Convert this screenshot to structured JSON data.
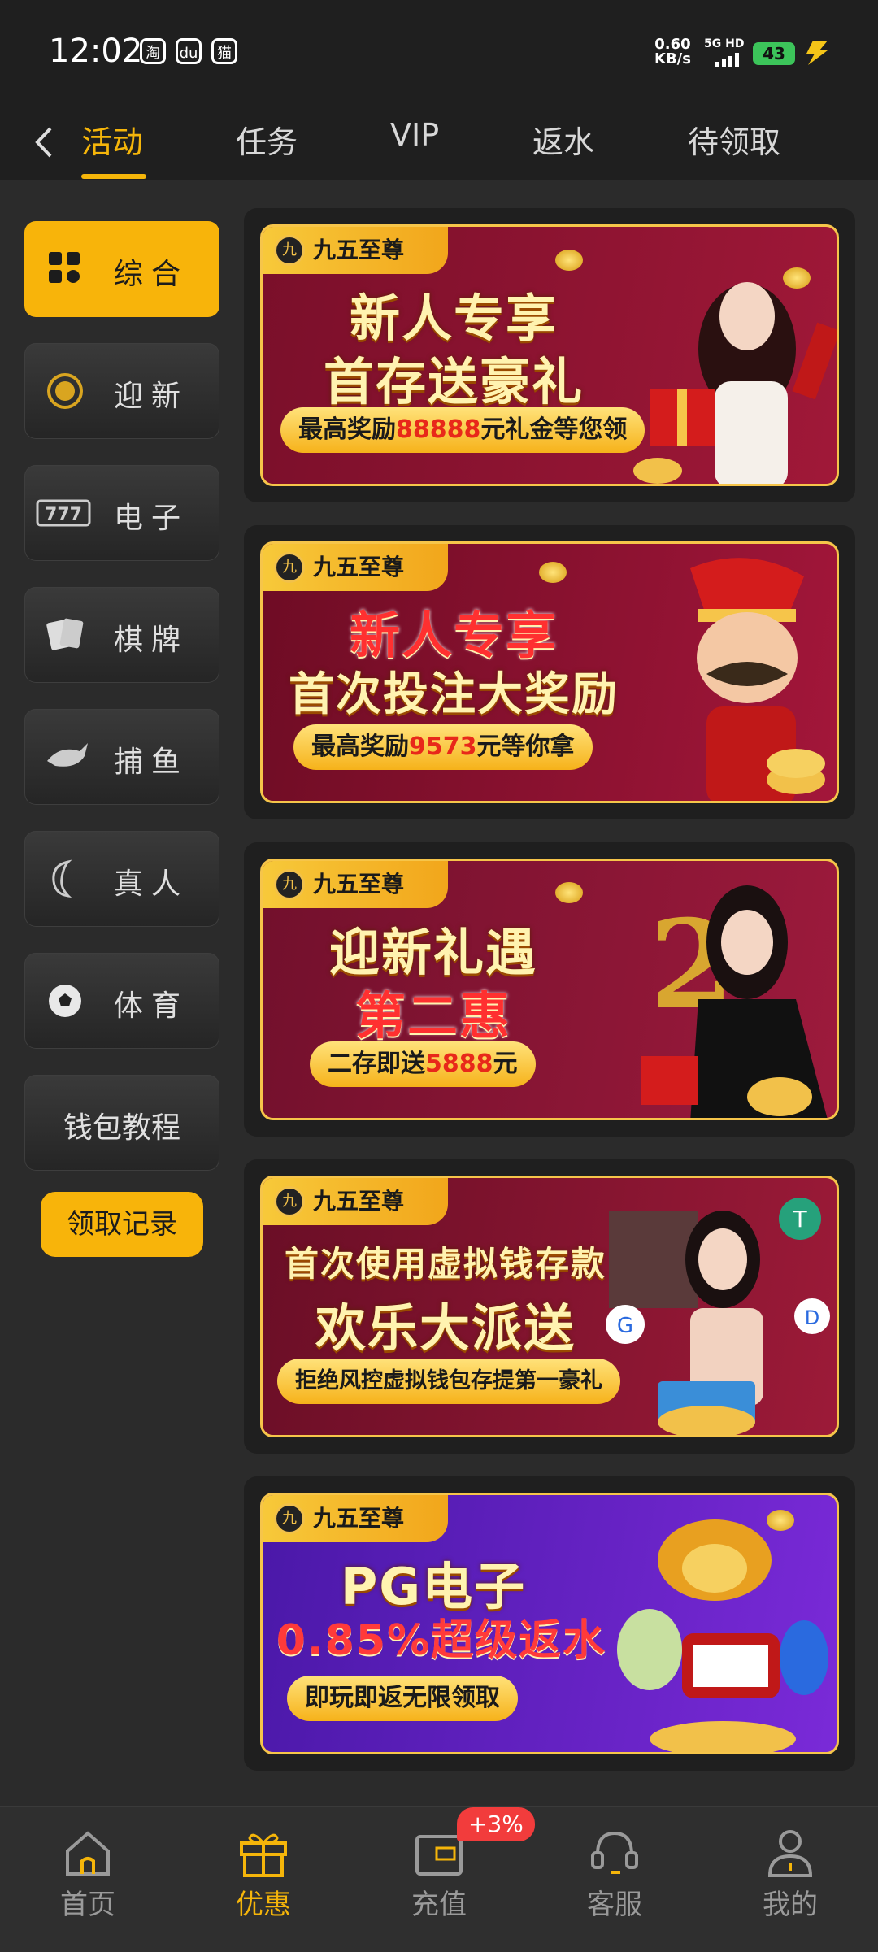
{
  "status_bar": {
    "time": "12:02",
    "apps": [
      "淘",
      "du",
      "猫"
    ],
    "speed_value": "0.60",
    "speed_unit": "KB/s",
    "network": "5G HD",
    "battery": "43"
  },
  "tabs": [
    {
      "label": "活动",
      "active": true
    },
    {
      "label": "任务"
    },
    {
      "label": "VIP"
    },
    {
      "label": "返水"
    },
    {
      "label": "待领取"
    }
  ],
  "sidebar": {
    "items": [
      {
        "label": "综合",
        "icon": "grid-icon",
        "active": true
      },
      {
        "label": "迎新",
        "icon": "coin-logo-icon"
      },
      {
        "label": "电子",
        "icon": "slot-777-icon"
      },
      {
        "label": "棋牌",
        "icon": "cards-icon"
      },
      {
        "label": "捕鱼",
        "icon": "shark-icon"
      },
      {
        "label": "真人",
        "icon": "face-icon"
      },
      {
        "label": "体育",
        "icon": "soccer-ball-icon"
      },
      {
        "label": "钱包教程"
      }
    ],
    "claim_button": "领取记录"
  },
  "banners": [
    {
      "brand": "九五至尊",
      "line1": "新人专享",
      "line2": "首存送豪礼",
      "pill_prefix": "最高奖励",
      "pill_highlight": "88888",
      "pill_suffix": "元礼金等您领",
      "bg_from": "#7a0f2a",
      "bg_to": "#a01838"
    },
    {
      "brand": "九五至尊",
      "line1": "新人专享",
      "line2": "首次投注大奖励",
      "pill_prefix": "最高奖励",
      "pill_highlight": "9573",
      "pill_suffix": "元等你拿",
      "bg_from": "#6e0c24",
      "bg_to": "#a3163a"
    },
    {
      "brand": "九五至尊",
      "line1": "迎新礼遇",
      "line2": "第二惠",
      "pill_prefix": "二存即送",
      "pill_highlight": "5888",
      "pill_suffix": "元",
      "bg_from": "#72102c",
      "bg_to": "#9d1a3c"
    },
    {
      "brand": "九五至尊",
      "line1": "首次使用虚拟钱存款",
      "line2": "欢乐大派送",
      "pill_prefix": "拒绝风控虚拟钱包存提第一豪礼",
      "pill_highlight": "",
      "pill_suffix": "",
      "bg_from": "#6a0e26",
      "bg_to": "#9c1a38"
    },
    {
      "brand": "九五至尊",
      "line1": "PG电子",
      "line2": "0.85%超级返水",
      "pill_prefix": "即玩即返无限领取",
      "pill_highlight": "",
      "pill_suffix": "",
      "bg_from": "#4a18a8",
      "bg_to": "#7a2ad8"
    }
  ],
  "bottom_nav": [
    {
      "label": "首页",
      "icon": "home-icon"
    },
    {
      "label": "优惠",
      "icon": "gift-icon",
      "active": true
    },
    {
      "label": "充值",
      "icon": "wallet-icon",
      "badge": "+3%"
    },
    {
      "label": "客服",
      "icon": "headset-icon"
    },
    {
      "label": "我的",
      "icon": "user-icon"
    }
  ],
  "colors": {
    "accent": "#f5b50a",
    "background": "#2b2b2b",
    "highlight_red": "#e8281a"
  }
}
